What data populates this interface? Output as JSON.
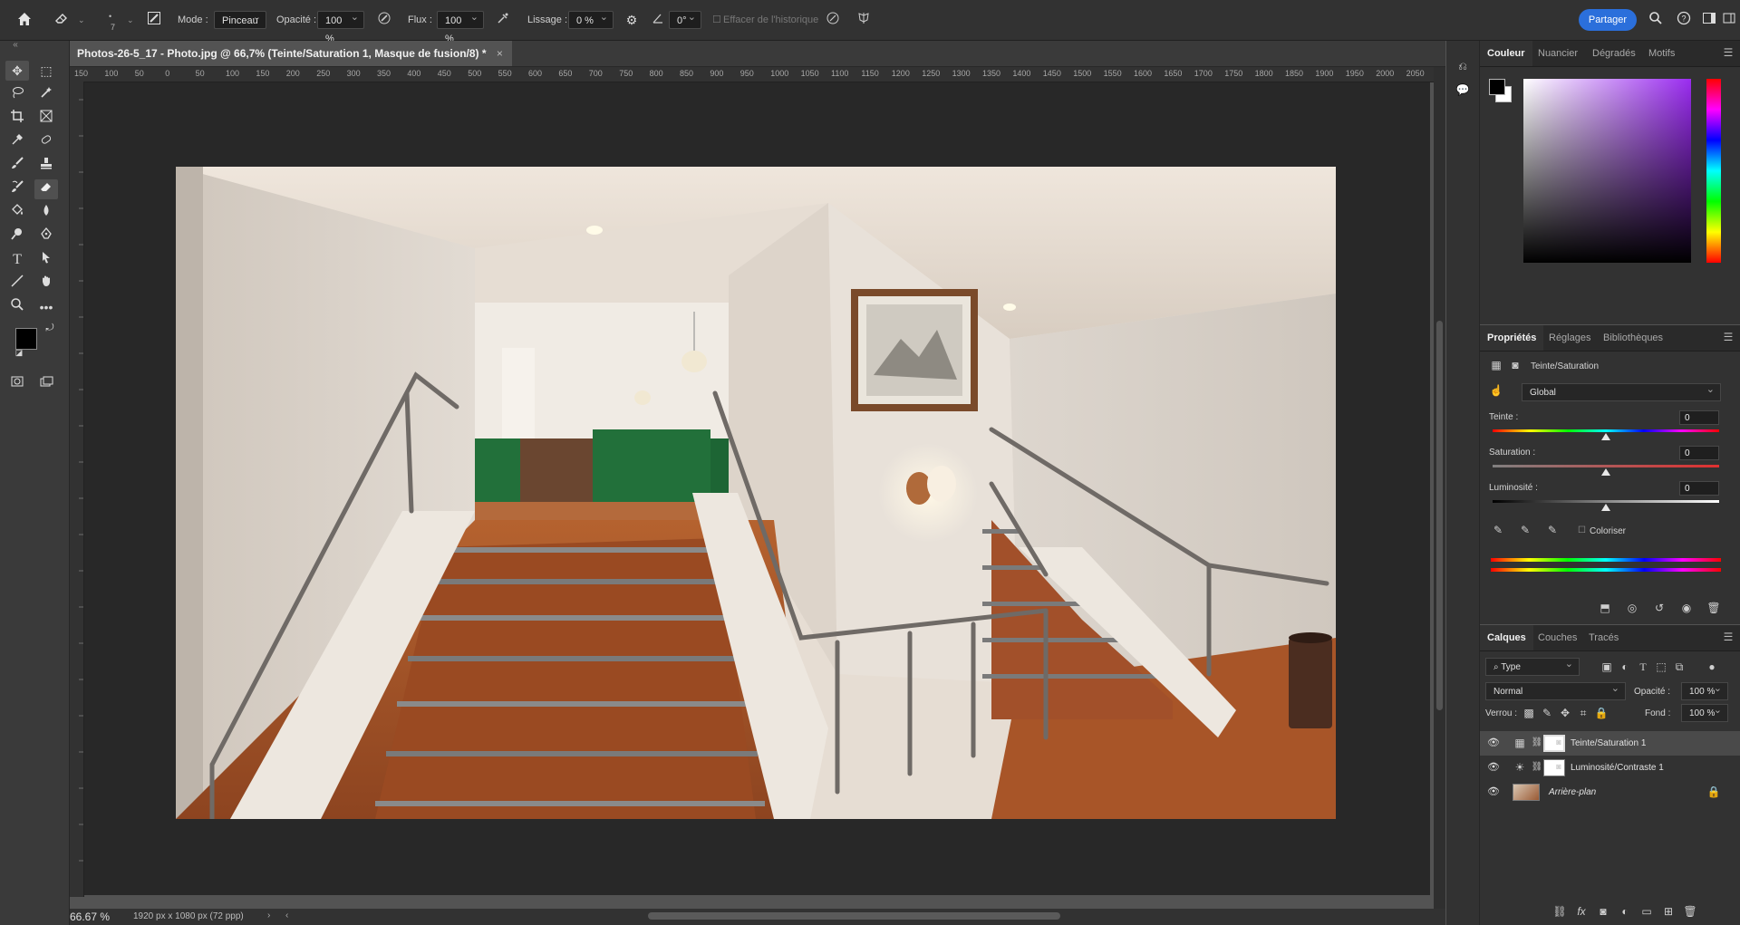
{
  "options_bar": {
    "mode_label": "Mode :",
    "mode_value": "Pinceau",
    "opacity_label": "Opacité :",
    "opacity_value": "100 %",
    "flow_label": "Flux :",
    "flow_value": "100 %",
    "smoothing_label": "Lissage :",
    "smoothing_value": "0 %",
    "angle_value": "0°",
    "brush_size": "7",
    "erase_history_label": "Effacer de l'historique",
    "share_label": "Partager"
  },
  "document": {
    "tab_title": "Photos-26-5_17 - Photo.jpg @ 66,7% (Teinte/Saturation 1, Masque de fusion/8) *",
    "close_glyph": "×"
  },
  "ruler": {
    "ticks": [
      "150",
      "100",
      "50",
      "0",
      "50",
      "100",
      "150",
      "200",
      "250",
      "300",
      "350",
      "400",
      "450",
      "500",
      "550",
      "600",
      "650",
      "700",
      "750",
      "800",
      "850",
      "900",
      "950",
      "1000",
      "1050",
      "1100",
      "1150",
      "1200",
      "1250",
      "1300",
      "1350",
      "1400",
      "1450",
      "1500",
      "1550",
      "1600",
      "1650",
      "1700",
      "1750",
      "1800",
      "1850",
      "1900",
      "1950",
      "2000",
      "2050"
    ]
  },
  "status": {
    "zoom": "66.67 %",
    "dimensions": "1920 px x 1080 px (72 ppp)"
  },
  "color_panel": {
    "tabs": [
      "Couleur",
      "Nuancier",
      "Dégradés",
      "Motifs"
    ],
    "active_tab": 0,
    "foreground": "#000000",
    "background": "#ffffff",
    "picker_hue": "#9a2cf0"
  },
  "properties_panel": {
    "tabs": [
      "Propriétés",
      "Réglages",
      "Bibliothèques"
    ],
    "active_tab": 0,
    "adjustment_title": "Teinte/Saturation",
    "preset": "Global",
    "hue_label": "Teinte :",
    "hue_value": "0",
    "saturation_label": "Saturation :",
    "saturation_value": "0",
    "lightness_label": "Luminosité :",
    "lightness_value": "0",
    "colorize_label": "Coloriser",
    "colorize_checked": false
  },
  "layers_panel": {
    "tabs": [
      "Calques",
      "Couches",
      "Tracés"
    ],
    "active_tab": 0,
    "filter_type": "Type",
    "blend_mode": "Normal",
    "opacity_label": "Opacité :",
    "opacity_value": "100 %",
    "lock_label": "Verrou :",
    "fill_label": "Fond :",
    "fill_value": "100 %",
    "layers": [
      {
        "name": "Teinte/Saturation 1",
        "selected": true,
        "kind": "adjustment-hue",
        "visible": true
      },
      {
        "name": "Luminosité/Contraste 1",
        "selected": false,
        "kind": "adjustment-brightness",
        "visible": true
      },
      {
        "name": "Arrière-plan",
        "selected": false,
        "kind": "image",
        "visible": true,
        "locked": true
      }
    ]
  },
  "colors": {
    "accent": "#2b6fdb",
    "ui_dark": "#323232",
    "canvas": "#282828"
  }
}
